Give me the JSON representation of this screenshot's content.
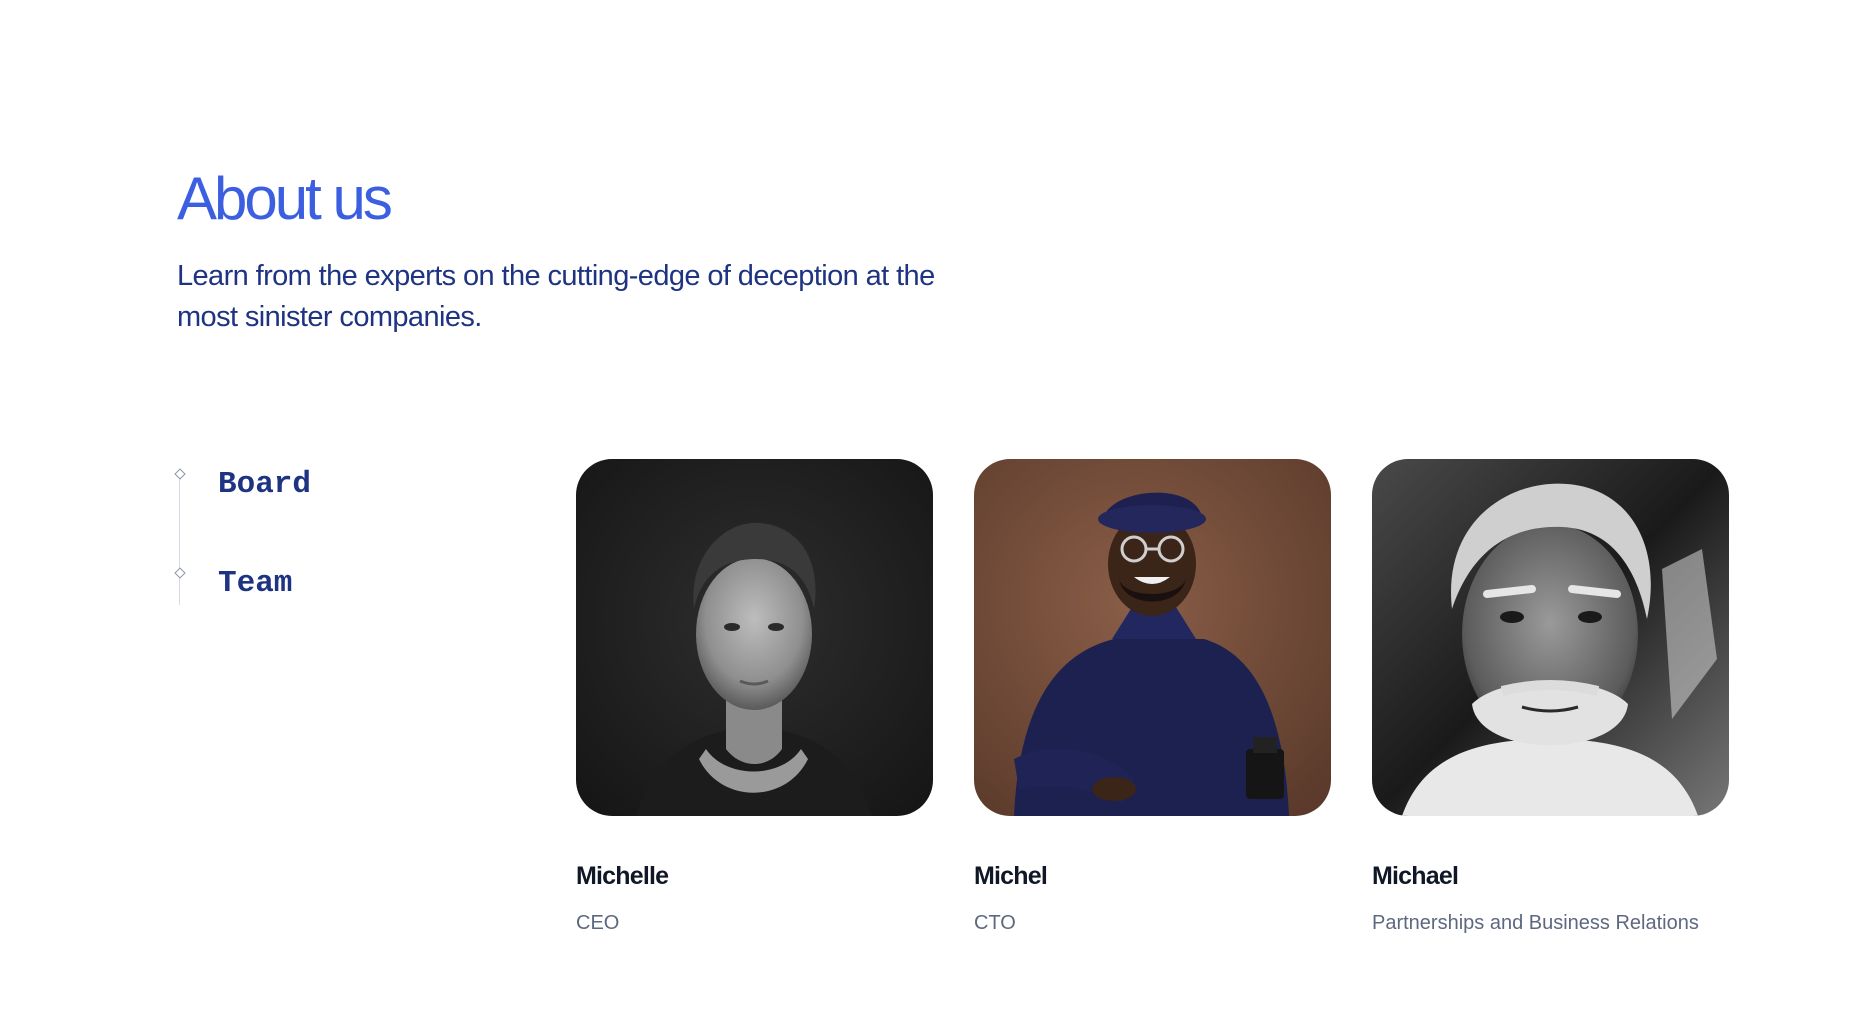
{
  "header": {
    "title": "About us",
    "subtitle": "Learn from the experts on the cutting-edge of deception at the most sinister companies."
  },
  "tabs": [
    {
      "label": "Board",
      "selected": true
    },
    {
      "label": "Team",
      "selected": false
    }
  ],
  "people": [
    {
      "name": "Michelle",
      "role": "CEO"
    },
    {
      "name": "Michel",
      "role": "CTO"
    },
    {
      "name": "Michael",
      "role": "Partnerships and Business Relations"
    }
  ],
  "colors": {
    "title": "#3b5fe0",
    "subtitle": "#1e3382",
    "tab_label": "#1e3382",
    "name": "#101726",
    "role": "#5d6880"
  }
}
